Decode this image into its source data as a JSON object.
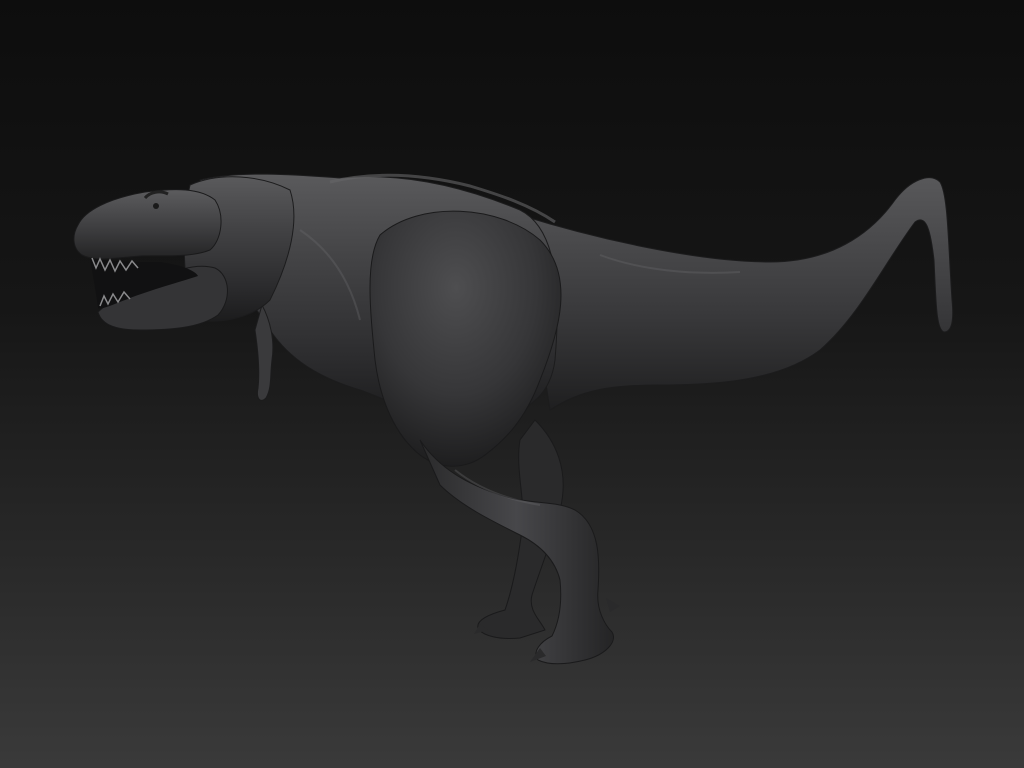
{
  "scene": {
    "subject_icon": "tyrannosaurus-sculpt",
    "colors": {
      "background_top": "#0d0d0d",
      "background_bottom": "#3a3a3a",
      "material_base": "#3c3c3e",
      "material_highlight": "#6a6a6c",
      "material_shadow": "#1a1a1b"
    }
  }
}
